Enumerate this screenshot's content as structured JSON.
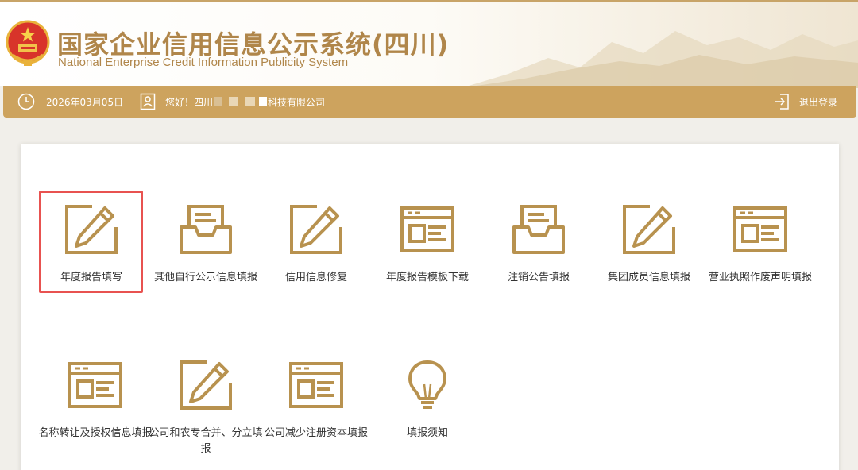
{
  "header": {
    "title": "国家企业信用信息公示系统(四川)",
    "subtitle": "National Enterprise Credit Information Publicity System"
  },
  "topbar": {
    "date": "2026年03月05日",
    "greeting_prefix": "您好！四川",
    "greeting_suffix": "科技有限公司",
    "logout_label": "退出登录"
  },
  "colors": {
    "accent": "#cda35e",
    "title": "#b0864a",
    "icon": "#b8924f",
    "highlight": "#e85250"
  },
  "tiles": [
    {
      "label": "年度报告填写",
      "icon": "edit-icon"
    },
    {
      "label": "其他自行公示信息填报",
      "icon": "inbox-icon"
    },
    {
      "label": "信用信息修复",
      "icon": "edit-icon"
    },
    {
      "label": "年度报告模板下载",
      "icon": "form-window-icon"
    },
    {
      "label": "注销公告填报",
      "icon": "inbox-icon"
    },
    {
      "label": "集团成员信息填报",
      "icon": "edit-icon"
    },
    {
      "label": "营业执照作废声明填报",
      "icon": "form-window-icon"
    },
    {
      "label": "名称转让及授权信息填报",
      "icon": "form-window-icon"
    },
    {
      "label": "公司和农专合并、分立填报",
      "icon": "edit-icon"
    },
    {
      "label": "公司减少注册资本填报",
      "icon": "form-window-icon"
    },
    {
      "label": "填报须知",
      "icon": "lightbulb-icon"
    }
  ]
}
